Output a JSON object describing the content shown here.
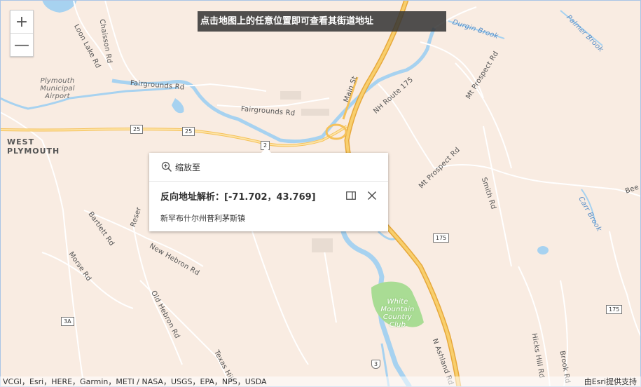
{
  "banner": {
    "text": "点击地图上的任意位置即可查看其街道地址"
  },
  "zoom": {
    "in_label": "+",
    "out_label": "—"
  },
  "popup": {
    "zoom_to_label": "缩放至",
    "title": "反向地址解析：[-71.702，43.769]",
    "address": "新罕布什尔州普利茅斯镇"
  },
  "attribution": {
    "sources": "VCGI，Esri，HERE，Garmin，METI / NASA，USGS，EPA，NPS，USDA",
    "powered_by": "由Esri提供支持"
  },
  "map_labels": {
    "loon_lake_rd": "Loon Lake Rd",
    "chaisson_rd": "Chaisson Rd",
    "plymouth_airport": "Plymouth Municipal Airport",
    "fairgrounds_rd_1": "Fairgrounds Rd",
    "fairgrounds_rd_2": "Fairgrounds Rd",
    "west_plymouth": "WEST PLYMOUTH",
    "main_st": "Main St",
    "nh_route_175": "NH Route 175",
    "durgin_brook": "Durgin Brook",
    "palmer_brook": "Palmer Brook",
    "mt_prospect_rd_1": "Mt Prospect Rd",
    "mt_prospect_rd_2": "Mt Prospect Rd",
    "smith_rd": "Smith Rd",
    "carr_brook": "Carr Brook",
    "bee": "Bee",
    "bartlett_rd": "Bartlett Rd",
    "reservoir": "Reser",
    "new_hebron_rd": "New Hebron Rd",
    "morse_rd": "Morse Rd",
    "old_hebron_rd": "Old Hebron Rd",
    "texas_hill": "Texas Hill",
    "white_mountain_cc": "White Mountain Country Club",
    "n_ashland_rd": "N Ashland Rd",
    "hicks_hill_rd": "Hicks Hill Rd",
    "brook_rd": "Brook Rd"
  },
  "shields": {
    "r25a": "25",
    "r25b": "25",
    "r2": "2",
    "r175a": "175",
    "r175b": "175",
    "r3a": "3A",
    "r3": "3"
  },
  "colors": {
    "land": "#f9ece2",
    "water": "#a7d2f0",
    "highway": "#f5c15a",
    "park": "#a9dc94"
  }
}
